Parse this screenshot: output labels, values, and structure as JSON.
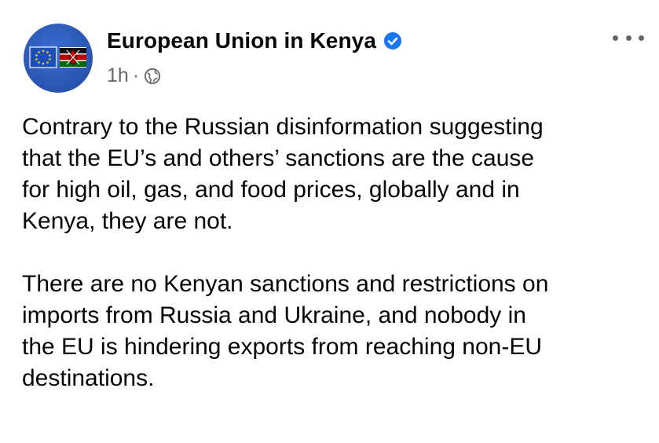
{
  "post": {
    "page_name": "European Union in Kenya",
    "timestamp": "1h",
    "separator": "·",
    "verified_icon": "verified-badge-icon",
    "privacy_icon": "globe-icon",
    "more_icon": "more-options-icon",
    "paragraphs": [
      "Contrary to the Russian disinformation suggesting\nthat the EU’s and others’ sanctions are the cause\nfor high oil, gas, and food prices, globally and in\nKenya, they are not.",
      "There are no Kenyan sanctions and restrictions on\nimports from Russia and Ukraine, and nobody in\nthe EU is hindering exports from reaching non-EU\ndestinations."
    ]
  },
  "colors": {
    "text": "#050505",
    "secondary_text": "#65676b",
    "verified_blue": "#1877f2",
    "avatar_blue": "#2b57b6"
  }
}
